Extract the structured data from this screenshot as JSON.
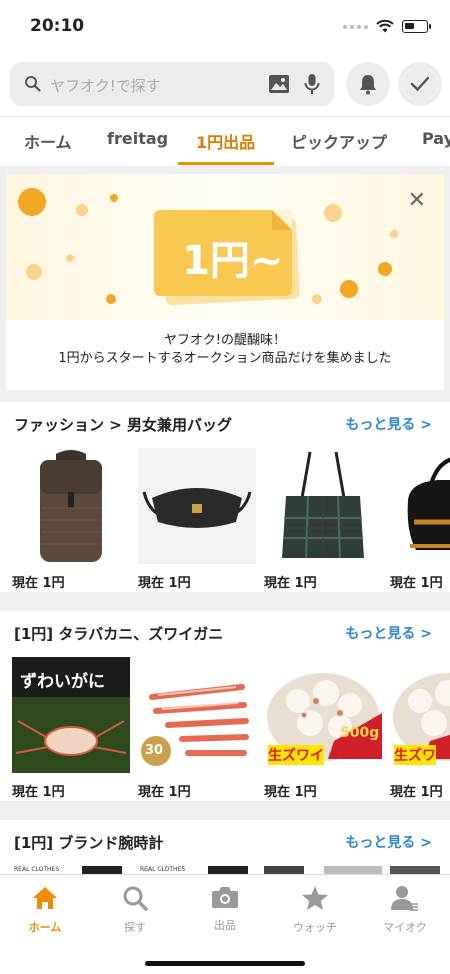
{
  "status_bar": {
    "time": "20:10"
  },
  "search": {
    "placeholder": "ヤフオク!で探す"
  },
  "tabs": [
    {
      "label": "ホーム",
      "active": false
    },
    {
      "label": "freitag",
      "active": false
    },
    {
      "label": "1円出品",
      "active": true
    },
    {
      "label": "ピックアップ",
      "active": false
    },
    {
      "label": "Pay",
      "active": false
    }
  ],
  "banner": {
    "art_text": "1円~",
    "line1": "ヤフオク!の醍醐味！",
    "line2": "1円からスタートするオークション商品だけを集めました"
  },
  "sections": [
    {
      "title": "ファッション > 男女兼用バッグ",
      "more": "もっと見る >",
      "items": [
        {
          "price": "現在 1円"
        },
        {
          "price": "現在 1円"
        },
        {
          "price": "現在 1円"
        },
        {
          "price": "現在 1円"
        }
      ]
    },
    {
      "title": "[1円] タラバカニ、ズワイガニ",
      "more": "もっと見る >",
      "items": [
        {
          "price": "現在 1円",
          "label": "ずわいがに"
        },
        {
          "price": "現在 1円",
          "label": "30"
        },
        {
          "price": "現在 1円",
          "label": "500g",
          "label2": "生ズワイ"
        },
        {
          "price": "現在 1円",
          "label": "生ズワ"
        }
      ]
    },
    {
      "title": "[1円] ブランド腕時計",
      "more": "もっと見る >",
      "items": [
        {
          "label": "REAL CLOTHES"
        },
        {
          "label": "REAL CLOTHES"
        }
      ]
    }
  ],
  "tabbar": [
    {
      "label": "ホーム",
      "icon": "home-icon",
      "active": true
    },
    {
      "label": "探す",
      "icon": "search-icon",
      "active": false
    },
    {
      "label": "出品",
      "icon": "camera-icon",
      "active": false
    },
    {
      "label": "ウォッチ",
      "icon": "star-icon",
      "active": false
    },
    {
      "label": "マイオク",
      "icon": "user-icon",
      "active": false
    }
  ],
  "colors": {
    "accent": "#f08c00",
    "link": "#2d86d8"
  }
}
